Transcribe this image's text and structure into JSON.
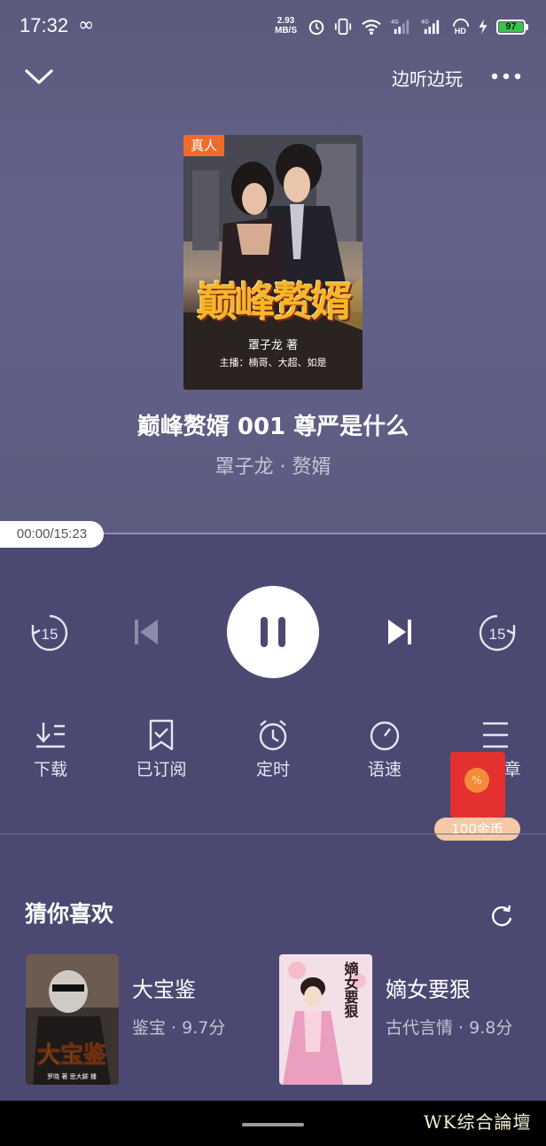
{
  "status_bar": {
    "time": "17:32",
    "loop_symbol": "∞",
    "net_speed_value": "2.93",
    "net_speed_unit": "MB/S",
    "battery": "97",
    "battery_color": "#37c64b"
  },
  "header": {
    "action_label": "边听边玩"
  },
  "cover": {
    "tag": "真人",
    "title": "巅峰赘婿",
    "author": "罩子龙 著",
    "narrators": "主播：楠哥、大超、如是"
  },
  "track": {
    "title": "巅峰赘婿 001 尊严是什么",
    "subtitle": "罩子龙 · 赘婿"
  },
  "progress": {
    "time": "00:00/15:23",
    "fraction": 0
  },
  "controls": {
    "rewind_seconds": "15",
    "forward_seconds": "15"
  },
  "actions": [
    {
      "label": "下载"
    },
    {
      "label": "已订阅"
    },
    {
      "label": "定时"
    },
    {
      "label": "语速"
    },
    {
      "label": "章"
    }
  ],
  "red_packet": {
    "coin_symbol": "%",
    "reward": "100金币"
  },
  "recommendations": {
    "heading": "猜你喜欢",
    "items": [
      {
        "name": "大宝鉴",
        "meta": "鉴宝 · 9.7分",
        "cover_text": "大宝鉴",
        "cover_author": "罗晓 著  思大脚 播"
      },
      {
        "name": "嫡女要狠",
        "meta": "古代言情 · 9.8分",
        "cover_text": "嫡女要狠"
      }
    ]
  },
  "watermark": "WK综合論壇",
  "colors": {
    "background": "#4b4972",
    "accent_tag": "#ef6b2b",
    "red_packet": "#e4302f"
  }
}
